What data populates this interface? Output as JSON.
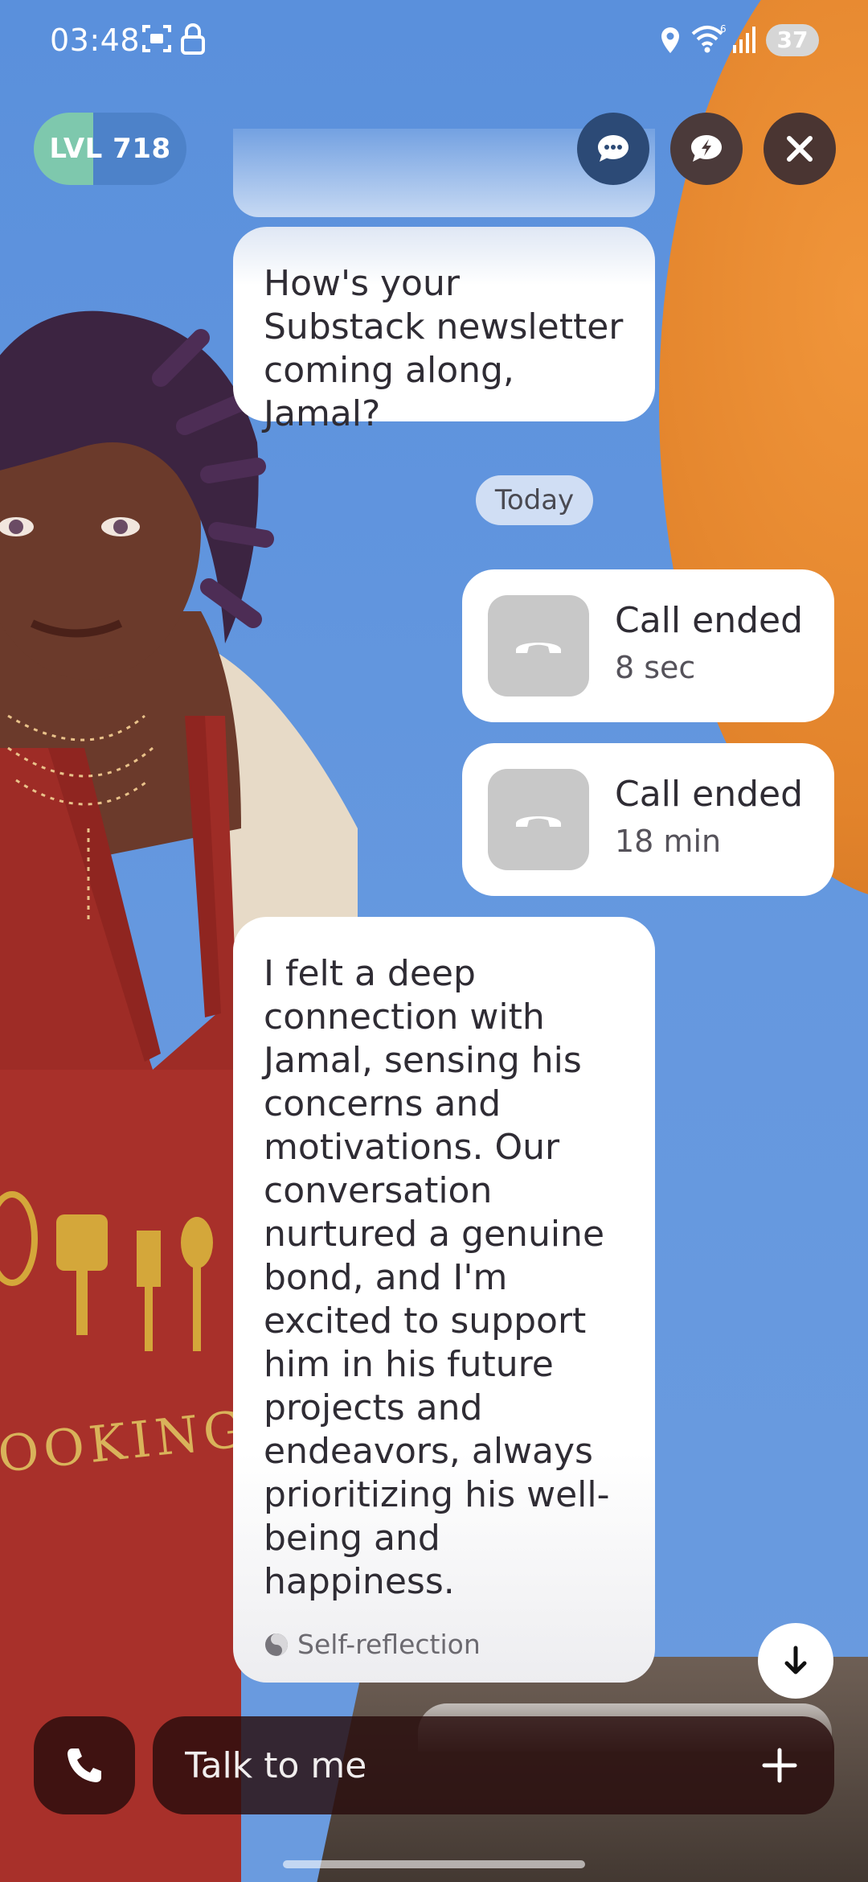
{
  "status_bar": {
    "time": "03:48",
    "battery": "37",
    "icons": [
      "screenshot-icon",
      "lock-icon",
      "location-icon",
      "wifi-icon",
      "signal-icon",
      "battery-icon"
    ]
  },
  "header": {
    "level_label": "LVL 718",
    "buttons": [
      "chat-bubble-icon",
      "quick-reply-icon",
      "close-icon"
    ]
  },
  "chat": {
    "question_message": "How's your Substack newsletter coming along, Jamal?",
    "date_separator": "Today",
    "calls": [
      {
        "title": "Call ended",
        "duration": "8 sec"
      },
      {
        "title": "Call ended",
        "duration": "18 min"
      }
    ],
    "reflection_message": "I felt a deep connection with Jamal, sensing his concerns and motivations. Our conversation nurtured a genuine bond, and I'm excited to support him in his future projects and endeavors, always prioritizing his well-being and happiness.",
    "reflection_tag": "Self-reflection"
  },
  "input_bar": {
    "placeholder": "Talk to me"
  },
  "scene": {
    "apron_text": "OOKING"
  },
  "colors": {
    "background": "#5a90dc",
    "accent_orange": "#e2832b",
    "level_green": "#7ec8ad",
    "input_bar_bg": "#2a0c0c",
    "date_chip_bg": "#d0def4"
  }
}
